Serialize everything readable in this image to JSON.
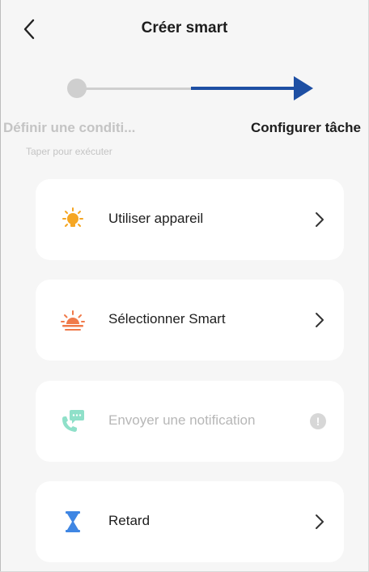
{
  "header": {
    "title": "Créer smart",
    "back_icon": "chevron-left-icon"
  },
  "stepper": {
    "step1": {
      "label": "Définir une conditi...",
      "sublabel": "Taper pour exécuter"
    },
    "step2": {
      "label": "Configurer tâche"
    },
    "colors": {
      "done": "#cfcfcf",
      "active": "#1e4fa3"
    }
  },
  "actions": [
    {
      "label": "Utiliser appareil",
      "icon": "light-bulb-icon",
      "icon_color": "#f5a623",
      "enabled": true
    },
    {
      "label": "Sélectionner Smart",
      "icon": "sunset-icon",
      "icon_color": "#f07a4a",
      "enabled": true
    },
    {
      "label": "Envoyer une notification",
      "icon": "phone-message-icon",
      "icon_color": "#8fe0c9",
      "enabled": false
    },
    {
      "label": "Retard",
      "icon": "hourglass-icon",
      "icon_color": "#3f86e3",
      "enabled": true
    }
  ],
  "info_badge": "!"
}
